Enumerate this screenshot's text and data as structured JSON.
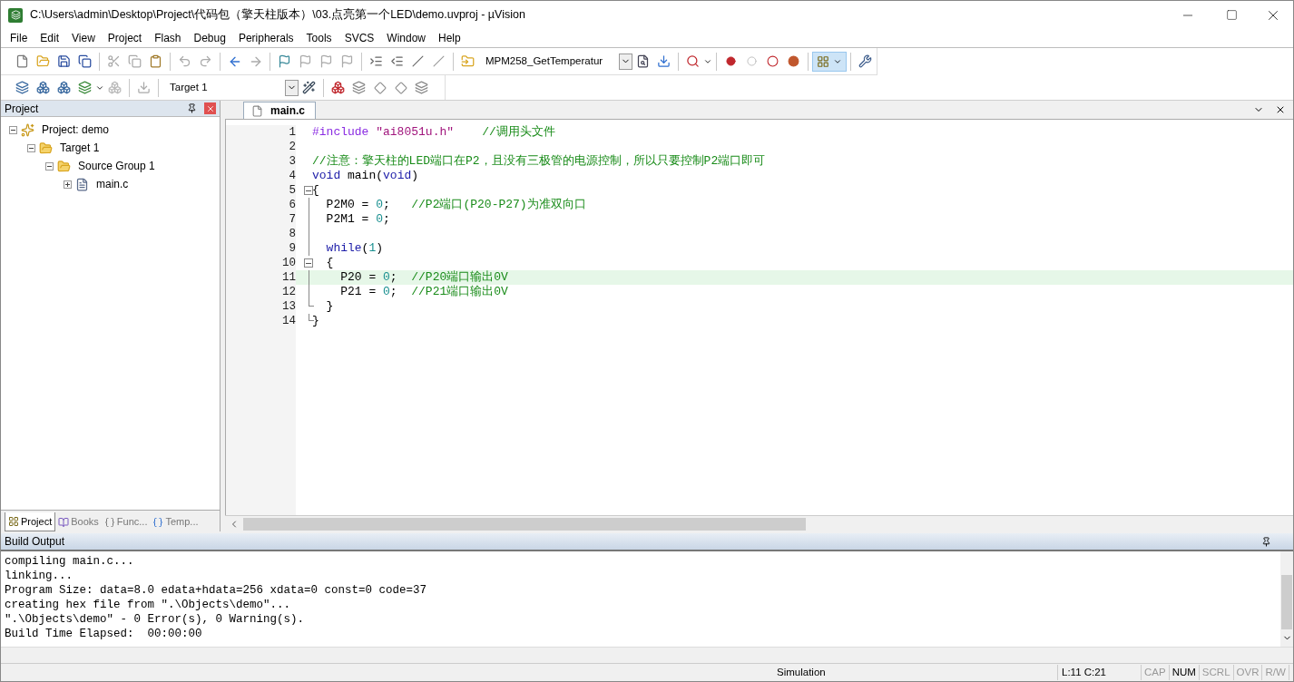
{
  "window": {
    "title": "C:\\Users\\admin\\Desktop\\Project\\代码包（擎天柱版本）\\03.点亮第一个LED\\demo.uvproj - µVision"
  },
  "menu": [
    "File",
    "Edit",
    "View",
    "Project",
    "Flash",
    "Debug",
    "Peripherals",
    "Tools",
    "SVCS",
    "Window",
    "Help"
  ],
  "toolbar": {
    "function_combo": "MPM258_GetTemperatur",
    "window_toggle": {
      "pressed": true
    },
    "target_combo": "Target 1"
  },
  "project_panel": {
    "title": "Project",
    "tree": [
      {
        "label": "Project: demo",
        "kind": "project",
        "expanded": true,
        "children": [
          {
            "label": "Target 1",
            "kind": "target",
            "expanded": true,
            "children": [
              {
                "label": "Source Group 1",
                "kind": "group",
                "expanded": true,
                "children": [
                  {
                    "label": "main.c",
                    "kind": "file",
                    "expanded": false
                  }
                ]
              }
            ]
          }
        ]
      }
    ],
    "tabs": [
      {
        "label": "Project",
        "selected": true
      },
      {
        "label": "Books",
        "selected": false
      },
      {
        "label": "Func...",
        "selected": false
      },
      {
        "label": "Temp...",
        "selected": false
      }
    ]
  },
  "editor": {
    "tabs": [
      {
        "label": "main.c",
        "selected": true
      }
    ],
    "lines": [
      {
        "number": "1",
        "kind": "plain",
        "current": false,
        "tokens": [
          {
            "kind": "preproc",
            "text": "#include "
          },
          {
            "kind": "string",
            "text": "\"ai8051u.h\""
          },
          {
            "kind": "comment",
            "text": "    //调用头文件"
          }
        ]
      },
      {
        "number": "2",
        "kind": "plain",
        "current": false
      },
      {
        "number": "3",
        "kind": "plain",
        "current": false,
        "tokens": [
          {
            "kind": "comment",
            "text": "//注意：擎天柱的LED端口在P2，且没有三极管的电源控制，所以只要控制P2端口即可"
          }
        ]
      },
      {
        "number": "4",
        "kind": "plain",
        "current": false,
        "tokens": [
          {
            "kind": "keyword",
            "text": "void"
          },
          {
            "kind": "plain",
            "text": " main("
          },
          {
            "kind": "keyword",
            "text": "void"
          },
          {
            "kind": "plain",
            "text": ")"
          }
        ]
      },
      {
        "number": "5",
        "kind": "fold_start",
        "current": false,
        "tokens": [
          {
            "kind": "plain",
            "text": "{"
          }
        ]
      },
      {
        "number": "6",
        "kind": "fold_line",
        "current": false,
        "tokens": [
          {
            "kind": "plain",
            "text": "  P2M0 = "
          },
          {
            "kind": "number",
            "text": "0"
          },
          {
            "kind": "plain",
            "text": ";   "
          },
          {
            "kind": "comment",
            "text": "//P2端口(P20-P27)为准双向口"
          }
        ]
      },
      {
        "number": "7",
        "kind": "fold_line",
        "current": false,
        "tokens": [
          {
            "kind": "plain",
            "text": "  P2M1 = "
          },
          {
            "kind": "number",
            "text": "0"
          },
          {
            "kind": "plain",
            "text": ";"
          }
        ]
      },
      {
        "number": "8",
        "kind": "fold_line",
        "current": false
      },
      {
        "number": "9",
        "kind": "fold_line",
        "current": false,
        "tokens": [
          {
            "kind": "keyword",
            "text": "  while"
          },
          {
            "kind": "plain",
            "text": "("
          },
          {
            "kind": "number",
            "text": "1"
          },
          {
            "kind": "plain",
            "text": ")"
          }
        ]
      },
      {
        "number": "10",
        "kind": "fold_start",
        "current": false,
        "tokens": [
          {
            "kind": "plain",
            "text": "  {"
          }
        ]
      },
      {
        "number": "11",
        "kind": "fold_line",
        "current": true,
        "tokens": [
          {
            "kind": "plain",
            "text": "    P20 = "
          },
          {
            "kind": "number",
            "text": "0"
          },
          {
            "kind": "plain",
            "text": ";  "
          },
          {
            "kind": "comment",
            "text": "//P20端口输出0V"
          }
        ]
      },
      {
        "number": "12",
        "kind": "fold_line",
        "current": false,
        "tokens": [
          {
            "kind": "plain",
            "text": "    P21 = "
          },
          {
            "kind": "number",
            "text": "0"
          },
          {
            "kind": "plain",
            "text": ";  "
          },
          {
            "kind": "comment",
            "text": "//P21端口输出0V"
          }
        ]
      },
      {
        "number": "13",
        "kind": "fold_end",
        "current": false,
        "tokens": [
          {
            "kind": "plain",
            "text": "  }"
          }
        ]
      },
      {
        "number": "14",
        "kind": "fold_end",
        "current": false,
        "tokens": [
          {
            "kind": "plain",
            "text": "}"
          }
        ]
      }
    ]
  },
  "build_output": {
    "title": "Build Output",
    "lines": [
      "compiling main.c...",
      "linking...",
      "Program Size: data=8.0 edata+hdata=256 xdata=0 const=0 code=37",
      "creating hex file from \".\\Objects\\demo\"...",
      "\".\\Objects\\demo\" - 0 Error(s), 0 Warning(s).",
      "Build Time Elapsed:  00:00:00"
    ]
  },
  "status_bar": {
    "mode": "Simulation",
    "position": "L:11 C:21",
    "indicators": [
      {
        "label": "CAP",
        "on": false
      },
      {
        "label": "NUM",
        "on": true
      },
      {
        "label": "SCRL",
        "on": false
      },
      {
        "label": "OVR",
        "on": false
      },
      {
        "label": "R/W",
        "on": false
      }
    ]
  }
}
